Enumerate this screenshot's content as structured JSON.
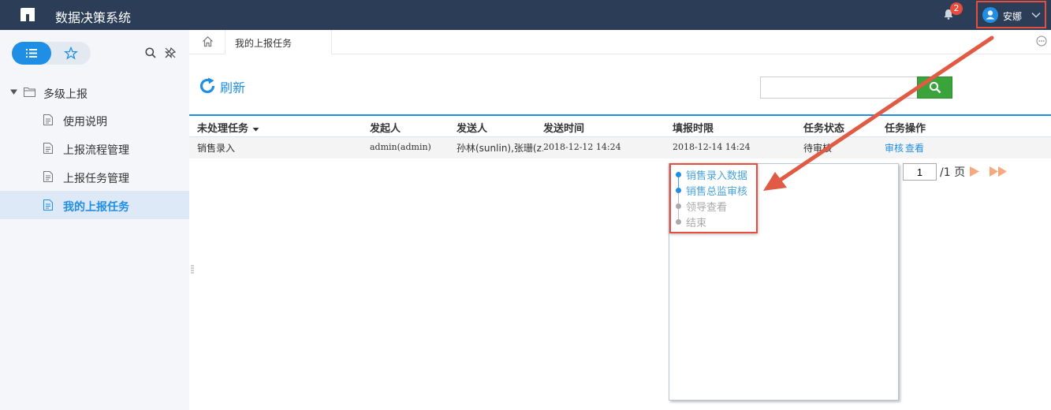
{
  "app": {
    "title": "数据决策系统"
  },
  "header": {
    "notification_count": "2",
    "user_name": "安娜"
  },
  "sidebar": {
    "tabs": [
      {
        "icon": "list-icon"
      },
      {
        "icon": "star-icon"
      }
    ],
    "root_label": "多级上报",
    "items": [
      {
        "label": "使用说明",
        "active": false
      },
      {
        "label": "上报流程管理",
        "active": false
      },
      {
        "label": "上报任务管理",
        "active": false
      },
      {
        "label": "我的上报任务",
        "active": true
      }
    ]
  },
  "tabs": {
    "active": "我的上报任务"
  },
  "toolbar": {
    "refresh_label": "刷新",
    "search_placeholder": ""
  },
  "table": {
    "columns": [
      "未处理任务",
      "发起人",
      "发送人",
      "发送时间",
      "填报时限",
      "任务状态",
      "任务操作"
    ],
    "rows": [
      {
        "task": "销售录入",
        "initiator": "admin(admin)",
        "sender": "孙林(sunlin),张珊(z…",
        "send_time": "2018-12-12 14:24",
        "deadline": "2018-12-14 14:24",
        "status": "待审核",
        "actions": [
          "审核",
          "查看"
        ]
      }
    ]
  },
  "pager": {
    "current": "1",
    "total_label": "/1 页"
  },
  "flow_popup": {
    "steps": [
      {
        "label": "销售录入数据",
        "done": true
      },
      {
        "label": "销售总监审核",
        "done": true
      },
      {
        "label": "领导查看",
        "done": false
      },
      {
        "label": "结束",
        "done": false
      }
    ]
  },
  "colors": {
    "header_bg": "#2c3e57",
    "accent": "#1f8ee5",
    "highlight": "#e84c3d",
    "search_btn": "#3aa33a"
  }
}
